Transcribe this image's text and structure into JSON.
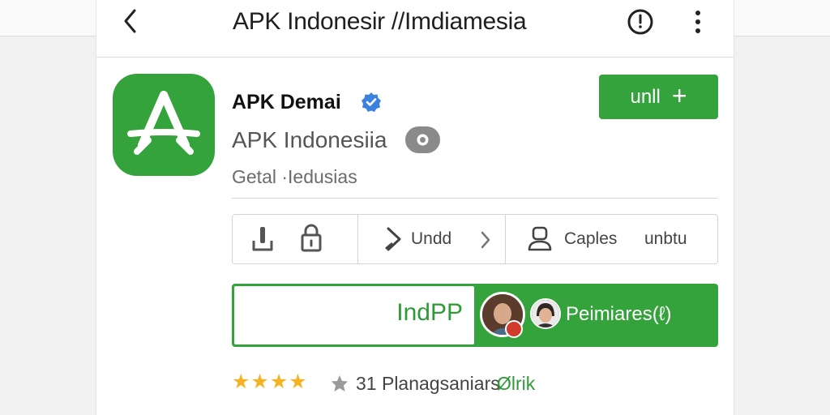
{
  "header": {
    "title": "APK Indonesir //Imdiamesia",
    "back_icon": "chevron-left-icon",
    "info_icon": "info-circle-icon",
    "more_icon": "more-vertical-icon"
  },
  "app": {
    "name": "APK Demai",
    "developer": "APK Indonesiia",
    "category": "Getal ·Iedusias",
    "icon": "android-a-logo-icon",
    "verified_icon": "verified-check-icon"
  },
  "install_button": {
    "label": "unll",
    "icon": "plus-icon"
  },
  "actions": {
    "download_icon": "download-icon",
    "lock_icon": "lock-icon",
    "share_icon": "arrow-right-icon",
    "share_label": "Undd",
    "chevron_icon": "chevron-right-icon",
    "person_icon": "person-icon",
    "caption_label": "Caples",
    "extra_label": "unbtu"
  },
  "promo": {
    "word": "IndPP",
    "label": "Peimiares(ℓ)"
  },
  "rating": {
    "stars": 3.5,
    "star_glyphs": "★★★★",
    "count_text": "31 Planagsaniars",
    "tag": "Ølrik"
  },
  "colors": {
    "brand_green": "#35a33c",
    "star": "#f5b324",
    "verified_blue": "#3b82e0"
  }
}
